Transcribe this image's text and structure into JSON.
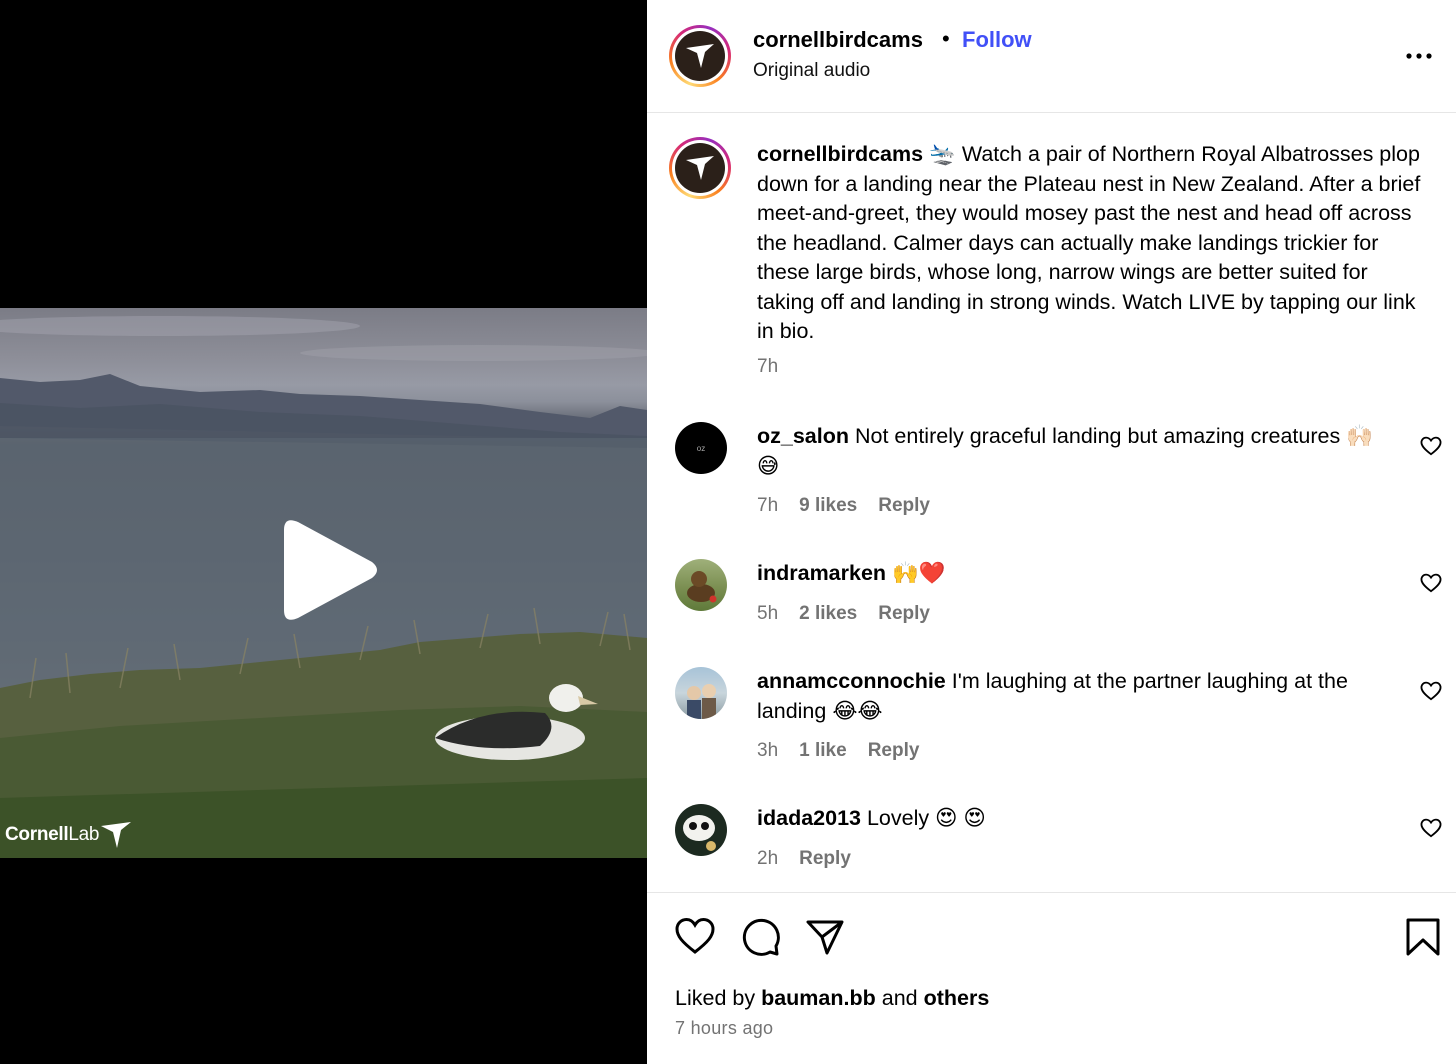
{
  "media": {
    "brand_bold": "Cornell",
    "brand_light": "Lab",
    "icons": {
      "play": "play-icon",
      "logo": "cornell-lab-bird-icon"
    }
  },
  "post": {
    "username": "cornellbirdcams",
    "separator": "•",
    "follow_label": "Follow",
    "audio_label": "Original audio",
    "more_icon": "more-icon"
  },
  "caption": {
    "username": "cornellbirdcams",
    "emoji": "🛬",
    "text": "Watch a pair of Northern Royal Albatrosses plop down for a landing near the Plateau nest in New Zealand. After a brief meet-and-greet, they would mosey past the nest and head off across the headland. Calmer days can actually make landings trickier for these large birds, whose long, narrow wings are better suited for taking off and landing in strong winds. Watch LIVE by tapping our link in bio.",
    "time": "7h"
  },
  "comments": [
    {
      "username": "oz_salon",
      "text": "Not entirely graceful landing but amazing creatures 🙌🏻 😅",
      "time": "7h",
      "likes": "9 likes",
      "reply": "Reply"
    },
    {
      "username": "indramarken",
      "text": "🙌❤️",
      "time": "5h",
      "likes": "2 likes",
      "reply": "Reply"
    },
    {
      "username": "annamcconnochie",
      "text": "I'm laughing at the partner laughing at the landing 😂😂",
      "time": "3h",
      "likes": "1 like",
      "reply": "Reply"
    },
    {
      "username": "idada2013",
      "text": "Lovely 😍 😍",
      "time": "2h",
      "likes": "",
      "reply": "Reply"
    }
  ],
  "footer": {
    "liked_prefix": "Liked by",
    "liked_user": "bauman.bb",
    "liked_and": "and",
    "liked_others": "others",
    "time_ago": "7 hours ago",
    "icons": [
      "heart-icon",
      "comment-icon",
      "share-icon",
      "bookmark-icon"
    ]
  },
  "colors": {
    "follow": "#4150f7",
    "muted": "#737373",
    "divider": "#e6e6e6"
  }
}
